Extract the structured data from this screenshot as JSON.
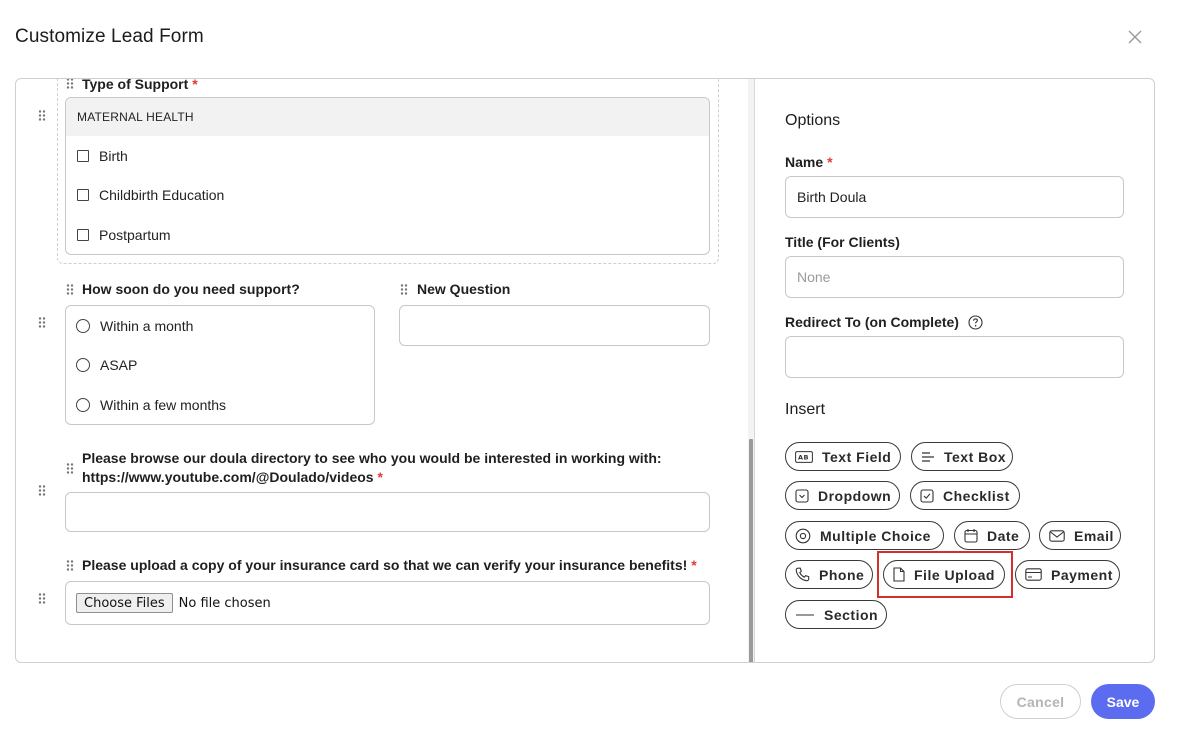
{
  "modal": {
    "title": "Customize Lead Form"
  },
  "form": {
    "q1": {
      "label": "Type of Support",
      "required_mark": "*",
      "group_header": "MATERNAL HEALTH",
      "options": [
        "Birth",
        "Childbirth Education",
        "Postpartum"
      ]
    },
    "q2": {
      "label": "How soon do you need support?",
      "options": [
        "Within a month",
        "ASAP",
        "Within a few months"
      ]
    },
    "q3": {
      "label": "New Question"
    },
    "q4": {
      "label_line1": "Please browse our doula directory to see who you would be interested in working with:",
      "label_line2": "https://www.youtube.com/@Doulado/videos",
      "required_mark": "*"
    },
    "q5": {
      "label": "Please upload a copy of your insurance card so that we can verify your insurance benefits!",
      "required_mark": "*",
      "choose_button": "Choose Files",
      "no_file_text": "No file chosen"
    }
  },
  "options_panel": {
    "title": "Options",
    "name_label": "Name",
    "name_required": "*",
    "name_value": "Birth Doula",
    "title_label": "Title (For Clients)",
    "title_placeholder": "None",
    "redirect_label": "Redirect To (on Complete)",
    "redirect_value": ""
  },
  "insert_panel": {
    "title": "Insert",
    "chips": {
      "text_field": "Text Field",
      "text_box": "Text Box",
      "dropdown": "Dropdown",
      "checklist": "Checklist",
      "multiple_choice": "Multiple Choice",
      "date": "Date",
      "email": "Email",
      "phone": "Phone",
      "file_upload": "File Upload",
      "payment": "Payment",
      "section": "Section"
    }
  },
  "footer": {
    "cancel": "Cancel",
    "save": "Save"
  },
  "colors": {
    "accent": "#5b6cf0",
    "required": "#e53935",
    "highlight": "#d32f2f"
  }
}
